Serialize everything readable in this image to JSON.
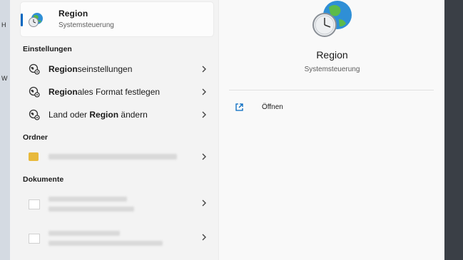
{
  "background": {
    "left_letters": [
      "H",
      "W"
    ]
  },
  "top_result": {
    "title": "Region",
    "subtitle": "Systemsteuerung",
    "icon": "globe-clock-icon"
  },
  "sections": {
    "settings": "Einstellungen",
    "folders": "Ordner",
    "documents": "Dokumente"
  },
  "settings_items": [
    {
      "bold_prefix": "Region",
      "rest": "seinstellungen",
      "icon": "region-settings-icon"
    },
    {
      "bold_prefix": "Region",
      "rest": "ales Format festlegen",
      "icon": "region-settings-icon"
    },
    {
      "plain_prefix": "Land oder ",
      "bold": "Region",
      "suffix": " ändern",
      "icon": "region-settings-icon"
    }
  ],
  "details": {
    "title": "Region",
    "subtitle": "Systemsteuerung",
    "open_label": "Öffnen",
    "icon": "globe-clock-icon"
  },
  "colors": {
    "accent": "#0067c0"
  }
}
